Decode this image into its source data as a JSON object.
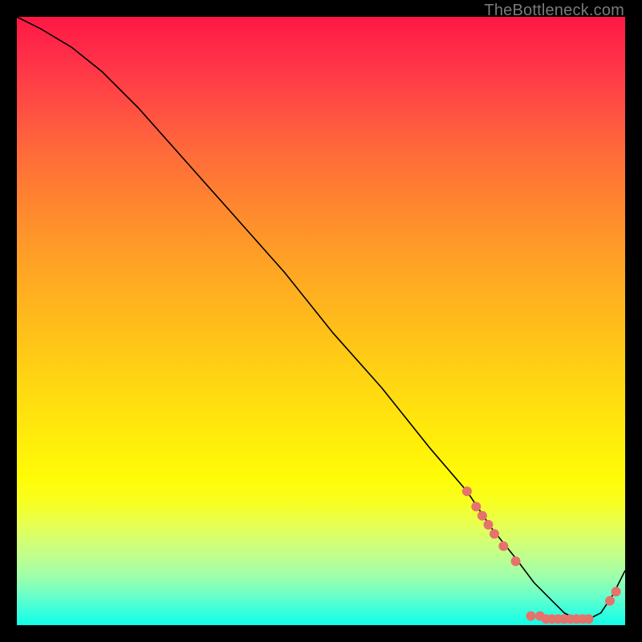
{
  "watermark": "TheBottleneck.com",
  "colors": {
    "dot": "#e6726c",
    "line": "#000000"
  },
  "chart_data": {
    "type": "line",
    "title": "",
    "xlabel": "",
    "ylabel": "",
    "xlim": [
      0,
      100
    ],
    "ylim": [
      0,
      100
    ],
    "grid": false,
    "series": [
      {
        "name": "curve",
        "x": [
          0,
          4,
          9,
          14,
          20,
          28,
          36,
          44,
          52,
          60,
          68,
          74,
          78,
          82,
          85,
          88,
          90,
          92,
          94,
          96,
          98,
          100
        ],
        "y": [
          100,
          98,
          95,
          91,
          85,
          76,
          67,
          58,
          48,
          39,
          29,
          22,
          16,
          11,
          7,
          4,
          2,
          1,
          1,
          2,
          5,
          9
        ]
      }
    ],
    "markers": [
      {
        "x": 74.0,
        "y": 22.0
      },
      {
        "x": 75.5,
        "y": 19.5
      },
      {
        "x": 76.5,
        "y": 18.0
      },
      {
        "x": 77.5,
        "y": 16.5
      },
      {
        "x": 78.5,
        "y": 15.0
      },
      {
        "x": 80.0,
        "y": 13.0
      },
      {
        "x": 82.0,
        "y": 10.5
      },
      {
        "x": 84.5,
        "y": 1.5
      },
      {
        "x": 86.0,
        "y": 1.5
      },
      {
        "x": 87.0,
        "y": 1.0
      },
      {
        "x": 88.0,
        "y": 1.0
      },
      {
        "x": 89.0,
        "y": 1.0
      },
      {
        "x": 90.0,
        "y": 1.0
      },
      {
        "x": 91.0,
        "y": 1.0
      },
      {
        "x": 92.0,
        "y": 1.0
      },
      {
        "x": 93.0,
        "y": 1.0
      },
      {
        "x": 94.0,
        "y": 1.0
      },
      {
        "x": 97.5,
        "y": 4.0
      },
      {
        "x": 98.5,
        "y": 5.5
      }
    ]
  }
}
